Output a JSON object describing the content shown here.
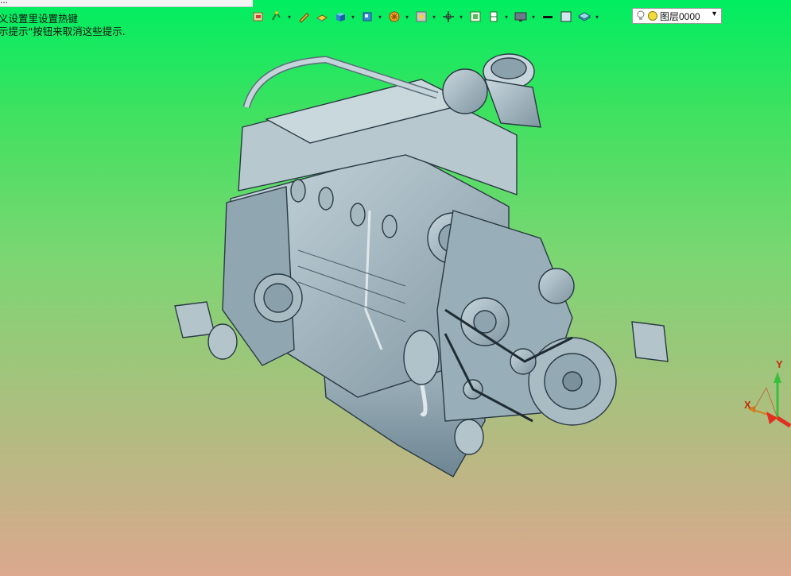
{
  "window": {
    "title_fragment": "...",
    "hint_line1": "义设置里设置热键",
    "hint_line2": "示提示\"按钮来取消这些提示."
  },
  "toolbar": {
    "items": [
      "open-icon",
      "snap-icon",
      "pencil-icon",
      "material-icon",
      "box-icon",
      "view-cube-icon",
      "render-icon",
      "light-icon",
      "move-icon",
      "frame-icon",
      "section-icon",
      "display-icon",
      "line-weight-icon",
      "color-swatch-icon",
      "layer-stack-icon"
    ]
  },
  "layer": {
    "current": "图层0000"
  },
  "axis": {
    "x_label": "X",
    "y_label": "Y"
  },
  "colors": {
    "background_top": "#00ee60",
    "background_bottom": "#dba88e",
    "model": "#9fb3bd"
  }
}
